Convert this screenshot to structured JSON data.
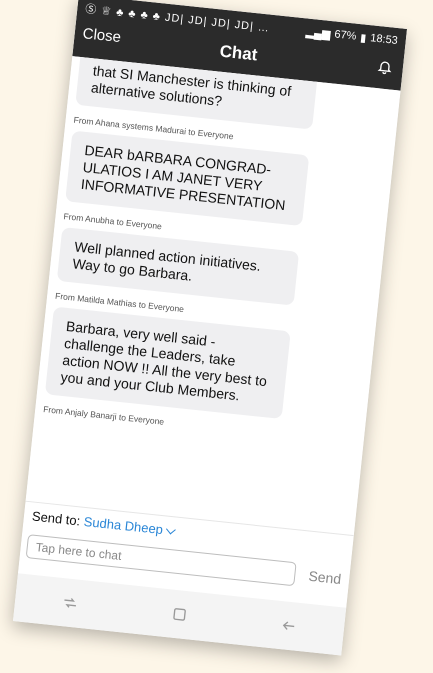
{
  "status_bar": {
    "left_icons": "Ⓢ ♕ ♣ ♣ ♣ ♣ JD| JD| JD| JD| …",
    "battery": "67%",
    "time": "18:53"
  },
  "header": {
    "close_label": "Close",
    "title": "Chat"
  },
  "messages": [
    {
      "from": "",
      "text": "that SI Manchester is thinking of alternative solutions?"
    },
    {
      "from": "From Ahana systems Madurai to Everyone",
      "text": "DEAR bARBARA CONGRAD-ULATIOS I AM JANET VERY INFORMATIVE PRESENTATION"
    },
    {
      "from": "From Anubha to Everyone",
      "text": "Well planned action initiatives. Way to go Barbara."
    },
    {
      "from": "From Matilda Mathias to Everyone",
      "text": "Barbara, very well said - challenge the Leaders, take action NOW !! All the very best to you and your Club Members."
    },
    {
      "from": "From Anjaly Banarji to Everyone",
      "text": ""
    }
  ],
  "composer": {
    "send_to_label": "Send to:",
    "send_to_value": "Sudha Dheep",
    "input_placeholder": "Tap here to chat",
    "send_label": "Send"
  }
}
